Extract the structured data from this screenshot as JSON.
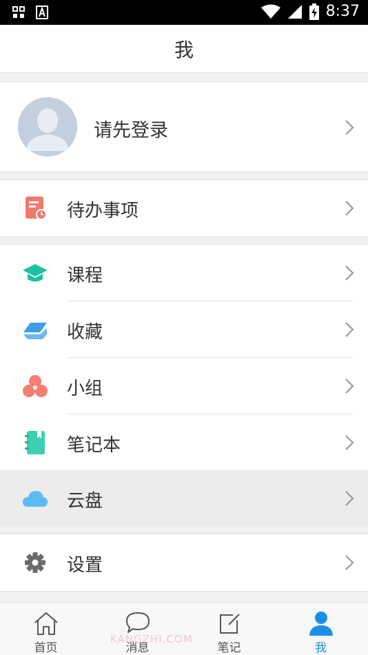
{
  "status_bar": {
    "time": "8:37",
    "icons": [
      "grid-icon",
      "font-a-icon",
      "wifi-icon",
      "signal-icon",
      "battery-charging-icon"
    ]
  },
  "header": {
    "title": "我"
  },
  "profile": {
    "login_label": "请先登录"
  },
  "menu": {
    "todo": {
      "label": "待办事项",
      "icon": "todo-icon"
    },
    "course": {
      "label": "课程",
      "icon": "graduation-cap-icon"
    },
    "favorites": {
      "label": "收藏",
      "icon": "favorites-icon"
    },
    "group": {
      "label": "小组",
      "icon": "group-icon"
    },
    "notebook": {
      "label": "笔记本",
      "icon": "notebook-icon"
    },
    "cloud": {
      "label": "云盘",
      "icon": "cloud-icon"
    },
    "settings": {
      "label": "设置",
      "icon": "gear-icon"
    }
  },
  "tabs": {
    "home": "首页",
    "messages": "消息",
    "notes": "笔记",
    "me": "我"
  },
  "watermark": "KANGZHI.COM",
  "colors": {
    "accent_blue": "#1a8fea",
    "todo_red": "#f07a6e",
    "course_teal": "#1ec1a2",
    "favorites_blue": "#3e9ee8",
    "group_coral": "#f47e6f",
    "notebook_teal": "#3ecfb1",
    "cloud_blue": "#5cbcf2",
    "gear_gray": "#6b6b6b"
  }
}
